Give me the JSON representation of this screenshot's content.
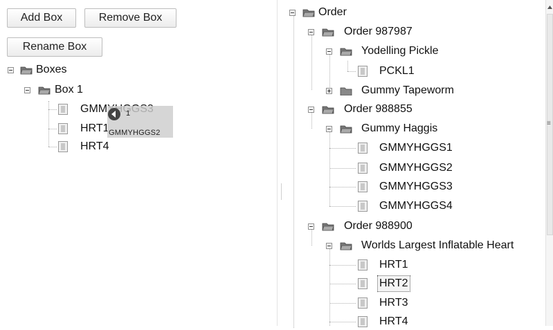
{
  "toolbar": {
    "add_label": "Add Box",
    "remove_label": "Remove Box",
    "rename_label": "Rename Box"
  },
  "left_tree": {
    "root": "Boxes",
    "box": "Box 1",
    "items": [
      "GMMYHGGS3",
      "HRT1",
      "HRT4"
    ]
  },
  "drag": {
    "count": "1",
    "item": "GMMYHGGS2"
  },
  "right_tree": {
    "root": "Order",
    "orders": [
      {
        "name": "Order 987987",
        "products": [
          {
            "name": "Yodelling Pickle",
            "expanded": true,
            "items": [
              "PCKL1"
            ]
          },
          {
            "name": "Gummy Tapeworm",
            "expanded": false,
            "items": []
          }
        ]
      },
      {
        "name": "Order 988855",
        "products": [
          {
            "name": "Gummy Haggis",
            "expanded": true,
            "items": [
              "GMMYHGGS1",
              "GMMYHGGS2",
              "GMMYHGGS3",
              "GMMYHGGS4"
            ]
          }
        ]
      },
      {
        "name": "Order 988900",
        "products": [
          {
            "name": "Worlds Largest Inflatable Heart",
            "expanded": true,
            "items": [
              "HRT1",
              "HRT2",
              "HRT3",
              "HRT4"
            ]
          }
        ]
      }
    ],
    "selected_item": "HRT2"
  },
  "scrollbar": {
    "grip_glyph": "≡"
  }
}
